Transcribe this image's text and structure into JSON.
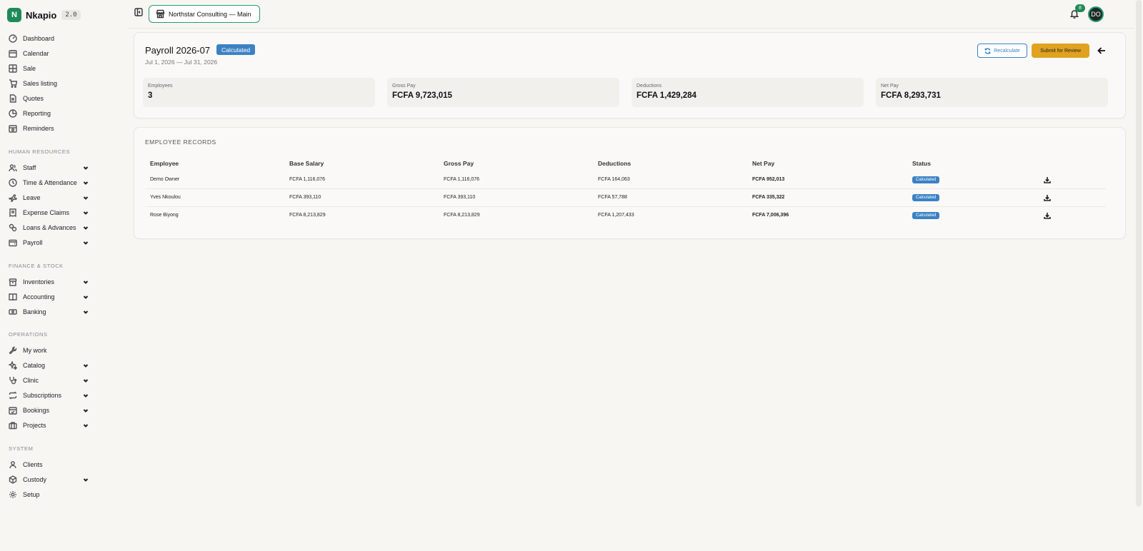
{
  "app": {
    "name": "Nkapio",
    "version": "2.0",
    "logo_letter": "N"
  },
  "sidebar": {
    "top_items": [
      {
        "label": "Dashboard",
        "icon": "dashboard-icon"
      },
      {
        "label": "Calendar",
        "icon": "calendar-icon"
      },
      {
        "label": "Sale",
        "icon": "grid-icon"
      },
      {
        "label": "Sales listing",
        "icon": "cart-icon"
      },
      {
        "label": "Quotes",
        "icon": "document-icon"
      },
      {
        "label": "Reporting",
        "icon": "chart-pie-icon"
      },
      {
        "label": "Reminders",
        "icon": "calendar-clock-icon"
      }
    ],
    "sections": [
      {
        "title": "HUMAN RESOURCES",
        "items": [
          {
            "label": "Staff",
            "icon": "users-icon",
            "expandable": true
          },
          {
            "label": "Time & Attendance",
            "icon": "clock-icon",
            "expandable": true
          },
          {
            "label": "Leave",
            "icon": "plane-icon",
            "expandable": true
          },
          {
            "label": "Expense Claims",
            "icon": "receipt-icon",
            "expandable": true
          },
          {
            "label": "Loans & Advances",
            "icon": "coins-icon",
            "expandable": true
          },
          {
            "label": "Payroll",
            "icon": "wallet-icon",
            "expandable": true
          }
        ]
      },
      {
        "title": "FINANCE & STOCK",
        "items": [
          {
            "label": "Inventories",
            "icon": "box-icon",
            "expandable": true
          },
          {
            "label": "Accounting",
            "icon": "book-icon",
            "expandable": true
          },
          {
            "label": "Banking",
            "icon": "banknote-icon",
            "expandable": true
          }
        ]
      },
      {
        "title": "OPERATIONS",
        "items": [
          {
            "label": "My work",
            "icon": "wrench-icon",
            "expandable": false
          },
          {
            "label": "Catalog",
            "icon": "sparkles-icon",
            "expandable": true
          },
          {
            "label": "Clinic",
            "icon": "stethoscope-icon",
            "expandable": true
          },
          {
            "label": "Subscriptions",
            "icon": "repeat-icon",
            "expandable": true
          },
          {
            "label": "Bookings",
            "icon": "calendar-check-icon",
            "expandable": true
          },
          {
            "label": "Projects",
            "icon": "briefcase-icon",
            "expandable": true
          }
        ]
      },
      {
        "title": "SYSTEM",
        "items": [
          {
            "label": "Clients",
            "icon": "user-icon",
            "expandable": false
          },
          {
            "label": "Custody",
            "icon": "package-icon",
            "expandable": true
          },
          {
            "label": "Setup",
            "icon": "gear-icon",
            "expandable": false
          }
        ]
      }
    ]
  },
  "topbar": {
    "org_name": "Northstar Consulting — Main",
    "notification_count": "8",
    "avatar_initials": "DO",
    "accent_color": "#1e8a5a"
  },
  "payroll": {
    "title": "Payroll 2026-07",
    "status": "Calculated",
    "date_range": "Jul 1, 2026 — Jul 31, 2026",
    "recalculate_label": "Recalculate",
    "submit_label": "Submit for Review",
    "stats": [
      {
        "label": "Employees",
        "value": "3"
      },
      {
        "label": "Gross Pay",
        "value": "FCFA 9,723,015"
      },
      {
        "label": "Deductions",
        "value": "FCFA 1,429,284"
      },
      {
        "label": "Net Pay",
        "value": "FCFA 8,293,731"
      }
    ],
    "status_color": "#3b82c4",
    "submit_color": "#e0a21f"
  },
  "records": {
    "title": "EMPLOYEE RECORDS",
    "columns": [
      "Employee",
      "Base Salary",
      "Gross Pay",
      "Deductions",
      "Net Pay",
      "Status"
    ],
    "rows": [
      {
        "employee": "Demo Owner",
        "base": "FCFA 1,116,076",
        "gross": "FCFA 1,116,076",
        "deductions": "FCFA 164,063",
        "net": "FCFA 952,013",
        "status": "Calculated"
      },
      {
        "employee": "Yves Nkoulou",
        "base": "FCFA 393,110",
        "gross": "FCFA 393,110",
        "deductions": "FCFA 57,788",
        "net": "FCFA 335,322",
        "status": "Calculated"
      },
      {
        "employee": "Rose Biyong",
        "base": "FCFA 8,213,829",
        "gross": "FCFA 8,213,829",
        "deductions": "FCFA 1,207,433",
        "net": "FCFA 7,006,396",
        "status": "Calculated"
      }
    ]
  }
}
